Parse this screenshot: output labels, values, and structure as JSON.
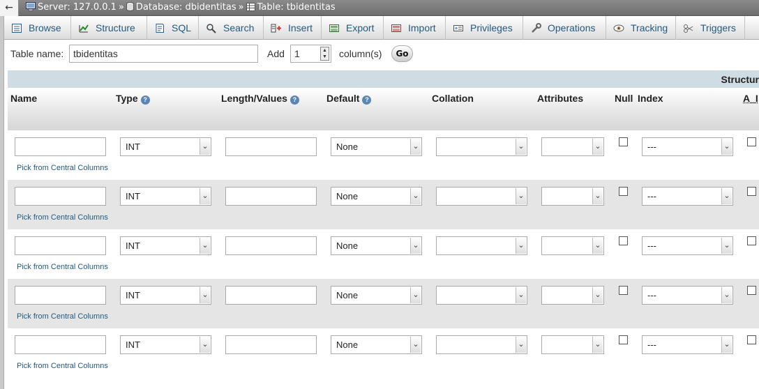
{
  "breadcrumb": {
    "back": "←",
    "items": [
      {
        "label": "Server: 127.0.0.1",
        "icon": "server-icon"
      },
      {
        "label": "Database: dbidentitas",
        "icon": "database-icon"
      },
      {
        "label": "Table: tbidentitas",
        "icon": "table-icon"
      }
    ],
    "separator": "»"
  },
  "tabs": [
    {
      "label": "Browse",
      "icon": "browse-icon"
    },
    {
      "label": "Structure",
      "icon": "structure-icon"
    },
    {
      "label": "SQL",
      "icon": "sql-icon"
    },
    {
      "label": "Search",
      "icon": "search-icon"
    },
    {
      "label": "Insert",
      "icon": "insert-icon"
    },
    {
      "label": "Export",
      "icon": "export-icon"
    },
    {
      "label": "Import",
      "icon": "import-icon"
    },
    {
      "label": "Privileges",
      "icon": "privileges-icon"
    },
    {
      "label": "Operations",
      "icon": "operations-icon"
    },
    {
      "label": "Tracking",
      "icon": "tracking-icon"
    },
    {
      "label": "Triggers",
      "icon": "triggers-icon"
    }
  ],
  "form": {
    "table_name_label": "Table name:",
    "table_name_value": "tbidentitas",
    "add_label": "Add",
    "add_value": "1",
    "columns_label": "column(s)",
    "go_label": "Go"
  },
  "table_header": {
    "structure": "Structur",
    "columns": [
      "Name",
      "Type",
      "Length/Values",
      "Default",
      "Collation",
      "Attributes",
      "Null",
      "Index",
      "A_I"
    ]
  },
  "rows": [
    {
      "type": "INT",
      "default": "None",
      "collation": "",
      "attributes": "",
      "index": "---",
      "pick": "Pick from Central Columns"
    },
    {
      "type": "INT",
      "default": "None",
      "collation": "",
      "attributes": "",
      "index": "---",
      "pick": "Pick from Central Columns"
    },
    {
      "type": "INT",
      "default": "None",
      "collation": "",
      "attributes": "",
      "index": "---",
      "pick": "Pick from Central Columns"
    },
    {
      "type": "INT",
      "default": "None",
      "collation": "",
      "attributes": "",
      "index": "---",
      "pick": "Pick from Central Columns"
    },
    {
      "type": "INT",
      "default": "None",
      "collation": "",
      "attributes": "",
      "index": "---",
      "pick": "Pick from Central Columns"
    }
  ],
  "colors": {
    "link": "#235a81",
    "header_band": "#d0dce4",
    "row_alt": "#e5e5e5"
  }
}
